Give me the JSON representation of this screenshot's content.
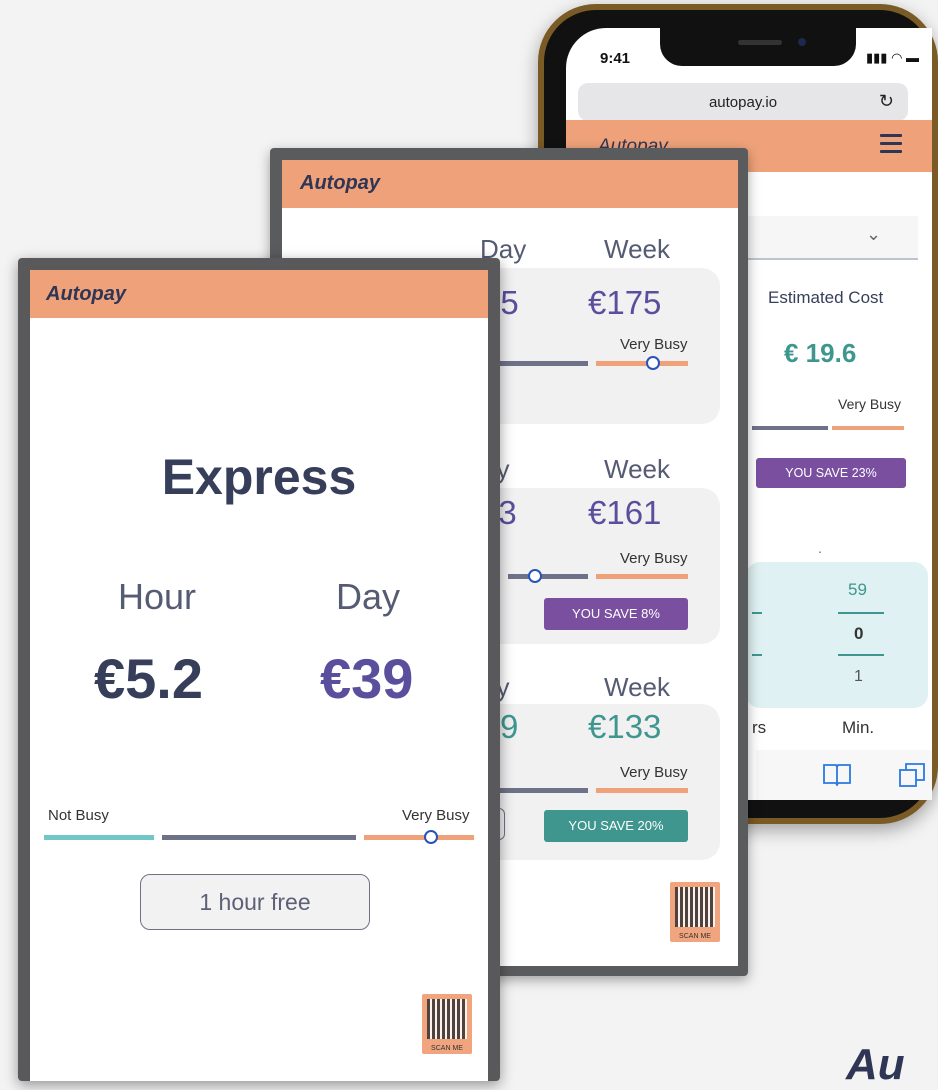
{
  "brand": "Autopay",
  "phone": {
    "time": "9:41",
    "status_icons": "▮▮▮ ◠ ▬",
    "url": "autopay.io",
    "reload_icon": "↻",
    "dot1": ".",
    "dot2": ".",
    "chevron": "⌄",
    "estimated_cost_label": "Estimated Cost",
    "estimated_cost_value": "€ 19.6",
    "busy_label": "Very Busy",
    "save_label": "YOU SAVE 23%",
    "counter": {
      "top": "59",
      "middle": "0",
      "bottom": "1"
    },
    "unit_min": "Min.",
    "unit_hours_fragment": "rs"
  },
  "middle_tablet": {
    "cards": [
      {
        "day_label": "Day",
        "week_label": "Week",
        "day_value": "25",
        "week_value": "€175",
        "busy_label": "Very Busy",
        "save_label": "",
        "level": 0.9
      },
      {
        "day_label": "ay",
        "week_label": "Week",
        "day_value": "23",
        "week_value": "€161",
        "busy_label": "Very Busy",
        "save_label": "YOU SAVE 8%",
        "level": 0.55
      },
      {
        "day_label": "ay",
        "week_label": "Week",
        "day_value": "9",
        "week_value": "€133",
        "busy_label": "Very Busy",
        "save_label": "YOU SAVE 20%",
        "level": null
      }
    ],
    "qr_label": "SCAN ME"
  },
  "front_tablet": {
    "title": "Express",
    "hour_label": "Hour",
    "day_label": "Day",
    "hour_price": "€5.2",
    "day_price": "€39",
    "not_busy_label": "Not Busy",
    "very_busy_label": "Very Busy",
    "busy_level": 0.9,
    "free_button_label": "1 hour free",
    "qr_label": "SCAN ME"
  },
  "bottom_logo_fragment": "Au",
  "colors": {
    "header_orange": "#efa27a",
    "navy": "#363e5a",
    "purple": "#7a4fa0",
    "teal": "#3e968f",
    "light_teal_bar": "#72c6c6"
  }
}
